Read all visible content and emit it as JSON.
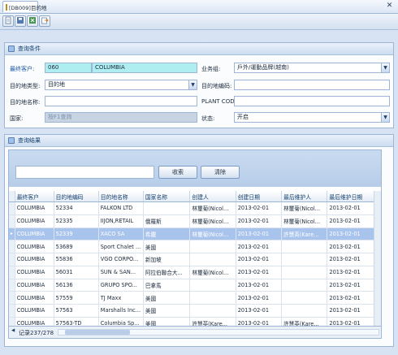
{
  "window": {
    "tab_title": "[DB009]目的地",
    "close_glyph": "✕"
  },
  "toolbar": {
    "buttons": [
      "file-icon",
      "save-icon",
      "excel-icon",
      "export-icon"
    ]
  },
  "query": {
    "title": "查询条件",
    "end_customer_label": "最终客户:",
    "end_customer_code": "060",
    "end_customer_name": "COLUMBIA",
    "business_group_label": "业务组:",
    "business_group_value": "戶外/運動品牌(越南)",
    "dest_type_label": "目的地类型:",
    "dest_type_value": "目的地",
    "dest_code_label": "目的地编码:",
    "dest_code_value": "",
    "dest_name_label": "目的地名称:",
    "dest_name_value": "",
    "plant_code_label": "PLANT CODE:",
    "plant_code_value": "",
    "country_label": "国家:",
    "country_value": "按F1查詢",
    "status_label": "状态:",
    "status_value": "开启"
  },
  "results": {
    "title": "查询结果",
    "search_value": "",
    "search_button": "收索",
    "clear_button": "清除",
    "columns": [
      "最终客户",
      "目的地编码",
      "目的地名称",
      "国家名称",
      "创建人",
      "创建日期",
      "最后维护人",
      "最后维护日期"
    ],
    "rows": [
      [
        "COLUMBIA",
        "52334",
        "FALKON LTD",
        "",
        "林璽菊(Nicol...",
        "2013-02-01",
        "林璽菊(Nicol...",
        "2013-02-01"
      ],
      [
        "COLUMBIA",
        "52335",
        "IIJON,RETAIL",
        "俄羅斯",
        "林璽菊(Nicol...",
        "2013-02-01",
        "林璽菊(Nicol...",
        "2013-02-01"
      ],
      [
        "COLUMBIA",
        "52339",
        "XACO SA",
        "希臘",
        "林璽菊(Nicol...",
        "2013-02-01",
        "許慧英(Kare...",
        "2013-02-01"
      ],
      [
        "COLUMBIA",
        "53689",
        "Sport Chalet ...",
        "美國",
        "",
        "2013-02-01",
        "",
        "2013-02-01"
      ],
      [
        "COLUMBIA",
        "55836",
        "VGO CORPO...",
        "新加坡",
        "",
        "2013-02-01",
        "",
        "2013-02-01"
      ],
      [
        "COLUMBIA",
        "56031",
        "SUN & SAN...",
        "阿拉伯聯合大...",
        "林璽菊(Nicol...",
        "2013-02-01",
        "",
        "2013-02-01"
      ],
      [
        "COLUMBIA",
        "56136",
        "GRUPO SPO...",
        "巴拿馬",
        "",
        "2013-02-01",
        "",
        "2013-02-01"
      ],
      [
        "COLUMBIA",
        "57559",
        "TJ Maxx",
        "美國",
        "",
        "2013-02-01",
        "",
        "2013-02-01"
      ],
      [
        "COLUMBIA",
        "57563",
        "Marshalls Inc...",
        "美國",
        "",
        "2013-02-01",
        "",
        "2013-02-01"
      ],
      [
        "COLUMBIA",
        "57563-TD",
        "Columbia Sp...",
        "美國",
        "許慧英(Kare...",
        "2013-02-01",
        "許慧英(Kare...",
        "2013-02-01"
      ]
    ],
    "selected_row": 2,
    "record_count": "记录237/278"
  },
  "colors": {
    "accent": "#1a55a6",
    "selection": "#a9c4ec",
    "cyan_field": "#aeeef0"
  }
}
